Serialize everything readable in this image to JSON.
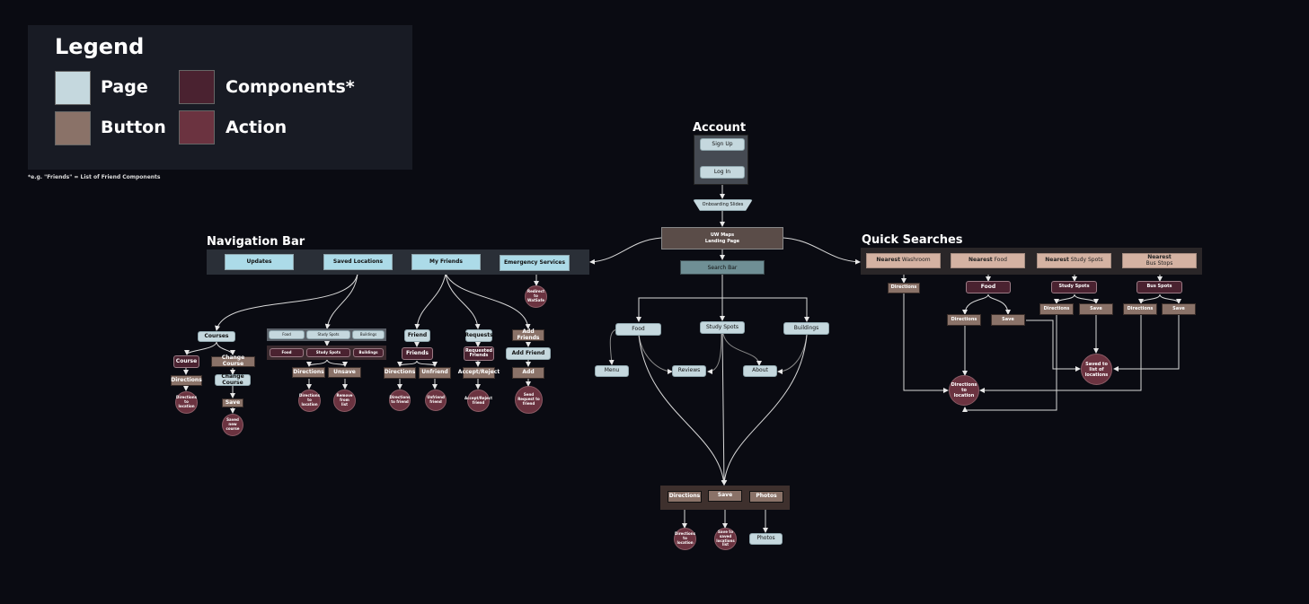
{
  "legend": {
    "title": "Legend",
    "items": [
      {
        "label": "Page",
        "color": "#c5d8de"
      },
      {
        "label": "Components*",
        "color": "#4a2230"
      },
      {
        "label": "Button",
        "color": "#8a7268"
      },
      {
        "label": "Action",
        "color": "#6b3340"
      }
    ],
    "footnote": "*e.g. \"Friends\" = List of Friend Components"
  },
  "account": {
    "title": "Account",
    "sign_up": "Sign Up",
    "log_in": "Log In",
    "onboarding": "Onboarding Slides",
    "landing": "UW Maps\nLanding Page",
    "search_bar": "Search Bar"
  },
  "nav": {
    "title": "Navigation Bar",
    "items": [
      "Updates",
      "Saved Locations",
      "My Friends",
      "Emergency Services"
    ],
    "emergency_action": "Redirect to WatSafe",
    "courses": {
      "page": "Courses",
      "course_comp": "Course",
      "directions_btn": "Directions",
      "directions_action": "Directions to location",
      "change_btn": "Change Course",
      "change_page": "Change Course",
      "save_btn": "Save",
      "save_action": "Saved new course"
    },
    "saved": {
      "tabs": [
        "Food",
        "Study Spots",
        "Buildings"
      ],
      "comps": [
        "Food",
        "Study Spots",
        "Buildings"
      ],
      "directions_btn": "Directions",
      "unsave_btn": "Unsave",
      "directions_action": "Directions to location",
      "unsave_action": "Remove from list"
    },
    "friends": {
      "friend_page": "Friend",
      "friends_comp": "Friends",
      "directions_btn": "Directions",
      "unfriend_btn": "Unfriend",
      "directions_action": "Directions to friend",
      "unfriend_action": "Unfriend friend",
      "requests_page": "Requests",
      "requested_comp": "Requested Friends",
      "accept_btn": "Accept/Reject",
      "accept_action": "Accept/Reject friend",
      "add_friends_btn": "Add Friends",
      "add_friend_page": "Add Friend",
      "add_btn": "Add",
      "add_action": "Send Request to friend"
    }
  },
  "search": {
    "categories": [
      "Food",
      "Study Spots",
      "Buildings"
    ],
    "subpages": [
      "Menu",
      "Reviews",
      "About"
    ],
    "actions_bar": [
      "Directions",
      "Save",
      "Photos"
    ],
    "directions_action": "Directions to location",
    "save_action": "Save to saved locations list",
    "photos_page": "Photos"
  },
  "quick": {
    "title": "Quick Searches",
    "items": [
      {
        "bold": "Nearest",
        "rest": "Washroom"
      },
      {
        "bold": "Nearest",
        "rest": "Food"
      },
      {
        "bold": "Nearest",
        "rest": "Study Spots"
      },
      {
        "bold": "Nearest",
        "rest": "Bus Stops"
      }
    ],
    "washroom_directions": "Directions",
    "food_comp": "Food",
    "study_comp": "Study Spots",
    "bus_comp": "Bus Spots",
    "directions_btn": "Directions",
    "save_btn": "Save",
    "directions_action": "Directions to location",
    "saved_action": "Saved to list of locations"
  }
}
